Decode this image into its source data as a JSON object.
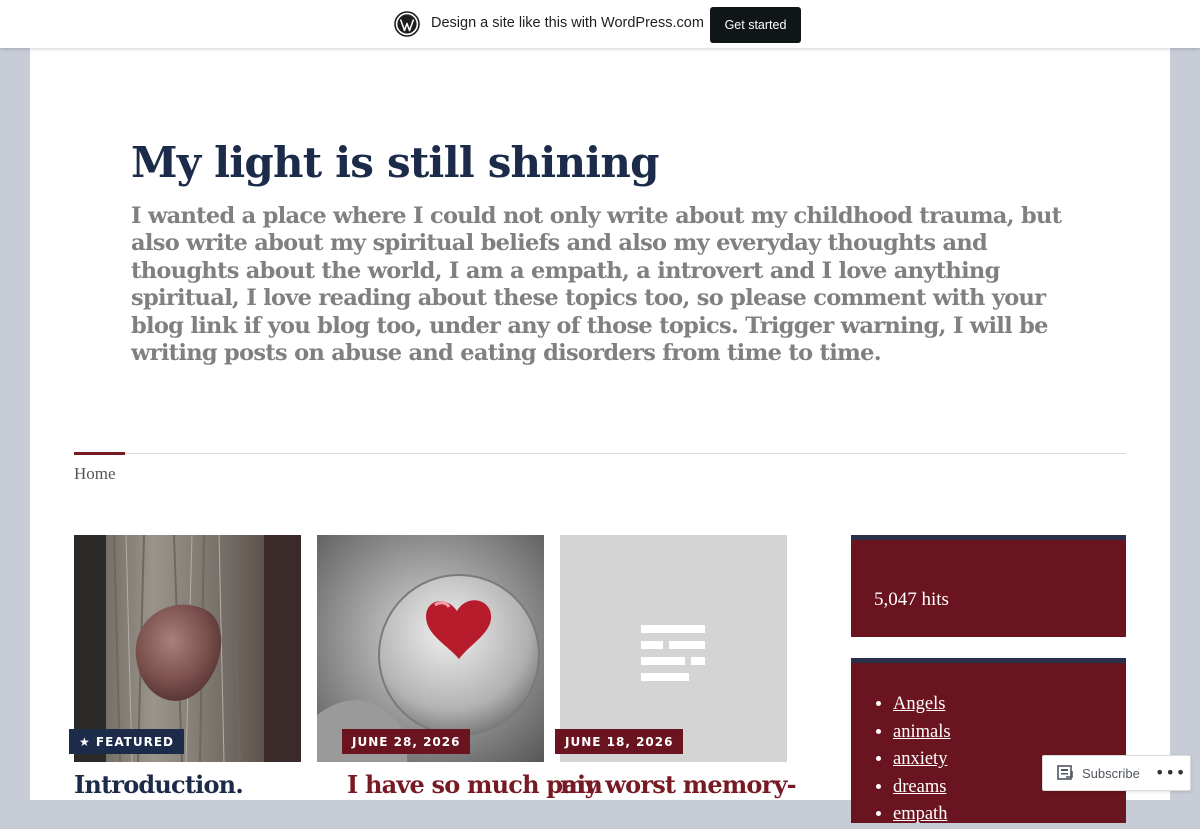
{
  "wp_banner": {
    "text": "Design a site like this with WordPress.com",
    "button_label": "Get started"
  },
  "site": {
    "title": "My light is still shining",
    "description": "I wanted a place where I could not only write about my childhood trauma, but also write about my spiritual beliefs and also my everyday thoughts and thoughts about the world, I am a empath, a introvert and I love anything spiritual, I love reading about these topics too, so please comment with your blog link if you blog too, under any of those topics. Trigger warning, I will be writing posts on abuse and eating disorders from time to time."
  },
  "nav": {
    "items": [
      {
        "label": "Home",
        "active": true
      }
    ]
  },
  "posts": [
    {
      "badge": "★ FEATURED",
      "title": "Introduction.",
      "badge_color": "#1c2b4a",
      "title_color": "#1c2b4a",
      "image": "stone-on-wood"
    },
    {
      "badge": "JUNE 28, 2026",
      "title": "I have so much pain",
      "badge_color": "#6a1420",
      "title_color": "#781a24",
      "image": "heart-in-glass"
    },
    {
      "badge": "JUNE 18, 2026",
      "title": "my worst memory-",
      "badge_color": "#6a1420",
      "title_color": "#781a24",
      "image": "text-placeholder-icon"
    }
  ],
  "sidebar": {
    "hits": "5,047 hits",
    "categories": [
      "Angels",
      "animals",
      "anxiety",
      "dreams",
      "empath"
    ]
  },
  "subscribe": {
    "label": "Subscribe",
    "more": "•••"
  },
  "colors": {
    "accent": "#781a24",
    "navy": "#1c2b4a",
    "widget_bg": "#6a1420"
  }
}
